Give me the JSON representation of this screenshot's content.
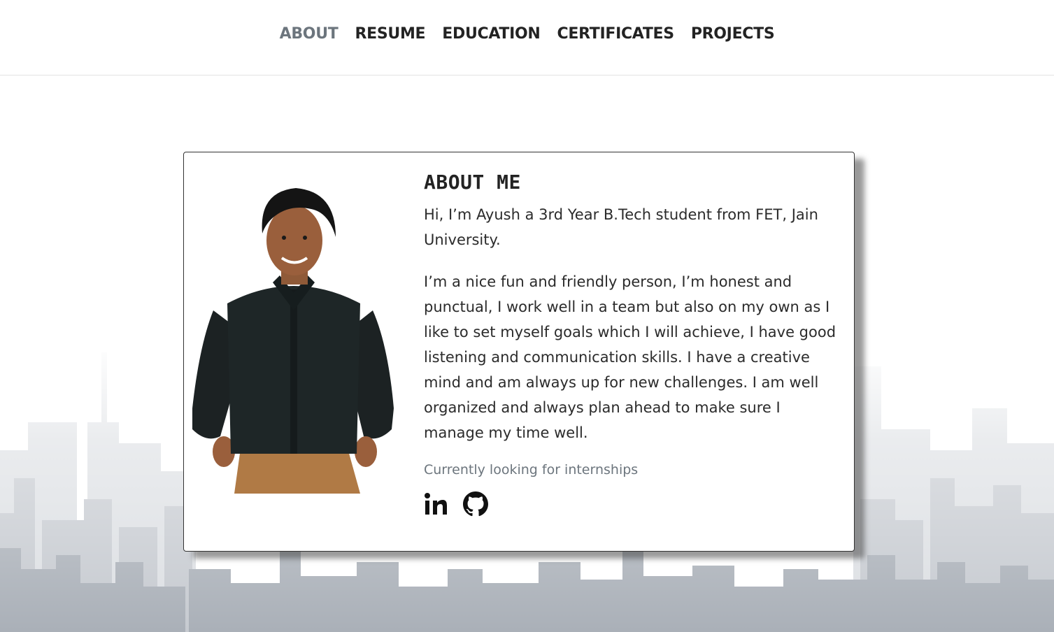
{
  "nav": {
    "items": [
      {
        "label": "ABOUT",
        "active": true
      },
      {
        "label": "RESUME"
      },
      {
        "label": "EDUCATION"
      },
      {
        "label": "CERTIFICATES"
      },
      {
        "label": "PROJECTS"
      }
    ]
  },
  "about": {
    "title": "ABOUT ME",
    "intro": "Hi, I’m Ayush a 3rd Year B.Tech student from FET, Jain University.",
    "bio": "I’m a nice fun and friendly person, I’m honest and punctual, I work well in a team but also on my own as I like to set myself goals which I will achieve, I have good listening and communication skills. I have a creative mind and am always up for new challenges. I am well organized and always plan ahead to make sure I manage my time well.",
    "status": "Currently looking for internships",
    "socials": [
      {
        "icon": "linkedin-icon"
      },
      {
        "icon": "github-icon"
      }
    ]
  },
  "colors": {
    "text": "#232323",
    "muted": "#6c757d",
    "skyline": "#aab0b8"
  }
}
